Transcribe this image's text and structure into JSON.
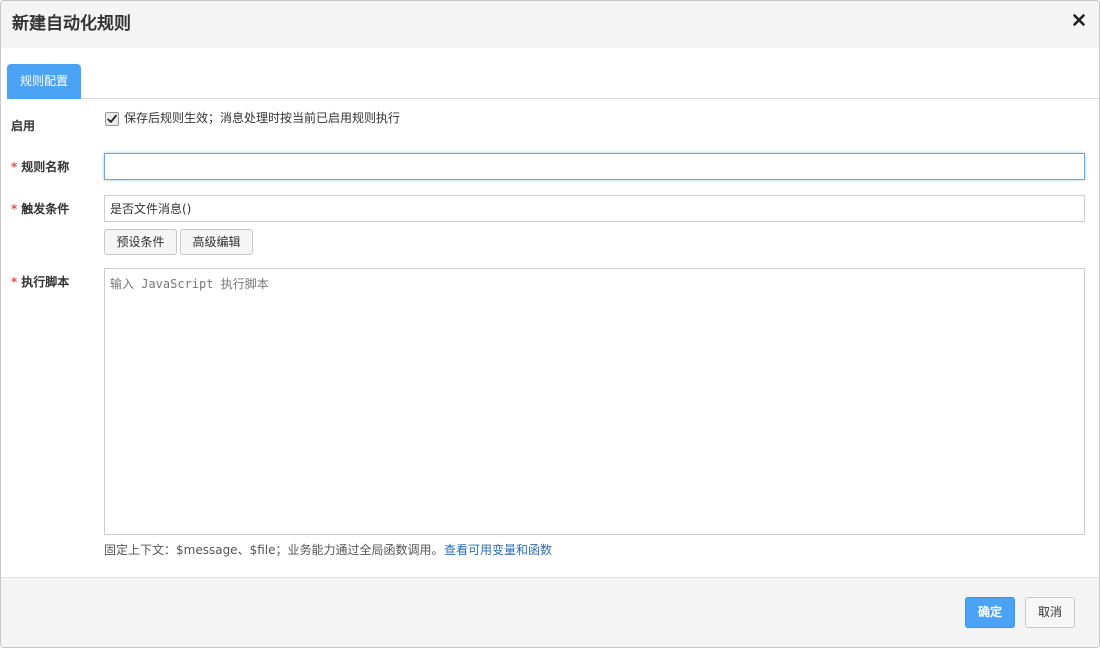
{
  "dialog": {
    "title": "新建自动化规则",
    "close_icon": "close-icon"
  },
  "tabs": [
    {
      "label": "规则配置",
      "active": true
    }
  ],
  "enable": {
    "label": "启用",
    "checked": true,
    "description": "保存后规则生效；消息处理时按当前已启用规则执行"
  },
  "rule_name": {
    "required_mark": "*",
    "label": "规则名称",
    "value": ""
  },
  "trigger": {
    "required_mark": "*",
    "label": "触发条件",
    "value": "是否文件消息()",
    "preset_button": "预设条件",
    "advanced_button": "高级编辑"
  },
  "script": {
    "required_mark": "*",
    "label": "执行脚本",
    "placeholder": "输入 JavaScript 执行脚本",
    "hint": "固定上下文：$message、$file；业务能力通过全局函数调用。",
    "link": "查看可用变量和函数"
  },
  "footer": {
    "confirm": "确定",
    "cancel": "取消"
  },
  "colors": {
    "accent": "#4aa3f5",
    "required": "#d9534f",
    "link": "#2a6db8"
  }
}
